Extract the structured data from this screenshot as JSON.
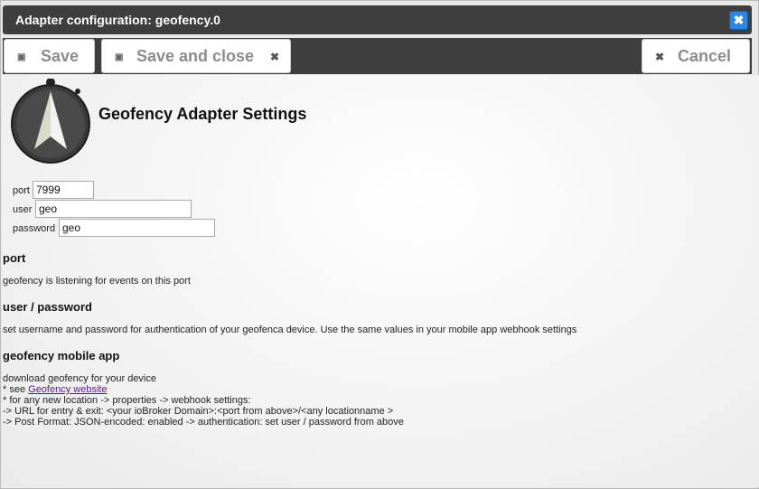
{
  "window": {
    "title": "Adapter configuration: geofency.0"
  },
  "toolbar": {
    "save_label": "Save",
    "save_close_label": "Save and close",
    "cancel_label": "Cancel"
  },
  "icons": {
    "close": "close-icon",
    "save": "floppy-disk-icon",
    "cancel": "x-icon"
  },
  "colors": {
    "titlebar": "#3e3e3e",
    "close_button": "#2a86e6",
    "link": "#551a8b"
  },
  "page": {
    "title": "Geofency Adapter Settings"
  },
  "form": {
    "port": {
      "label": "port",
      "value": "7999"
    },
    "user": {
      "label": "user",
      "value": "geo"
    },
    "password": {
      "label": "password",
      "value": "geo"
    }
  },
  "help": {
    "port_heading": "port",
    "port_text": "geofency is listening for events on this port",
    "user_heading": "user / password",
    "user_text": "set username and password for authentication of your geofenca device. Use the same values in your mobile app webhook settings",
    "app_heading": "geofency mobile app",
    "app_line1": "download geofency for your device",
    "app_line2_prefix": "* see ",
    "app_link": "Geofency website",
    "app_line3": "* for any new location -> properties -> webhook settings:",
    "app_line4": "-> URL for entry & exit: <your ioBroker Domain>:<port from above>/<any locationname >",
    "app_line5": "-> Post Format: JSON-encoded: enabled -> authentication: set user / password from above"
  }
}
